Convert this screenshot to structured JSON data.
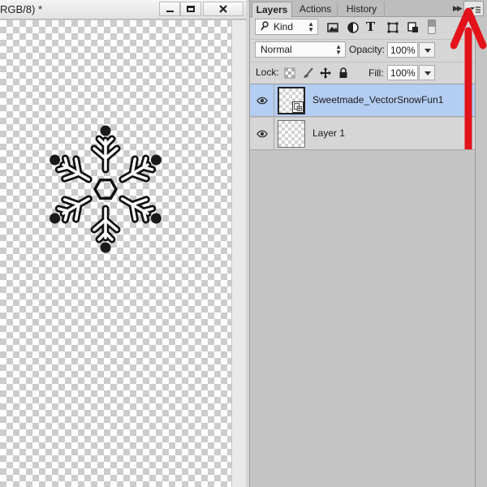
{
  "document": {
    "title": "RGB/8) *",
    "window_buttons": {
      "minimize": "minimize",
      "maximize": "maximize",
      "close": "close"
    }
  },
  "panel": {
    "tabs": [
      {
        "label": "Layers",
        "active": true
      },
      {
        "label": "Actions",
        "active": false
      },
      {
        "label": "History",
        "active": false
      }
    ],
    "collapse_icon": "double-chevron-right",
    "menu_icon": "panel-menu-icon",
    "filter": {
      "kind_label": "Kind",
      "icons": [
        "image-filter-icon",
        "adjustment-filter-icon",
        "type-filter-icon",
        "shape-filter-icon",
        "smart-object-filter-icon"
      ],
      "type_glyph": "T"
    },
    "blend_mode": "Normal",
    "opacity_label": "Opacity:",
    "opacity_value": "100%",
    "lock_label": "Lock:",
    "fill_label": "Fill:",
    "fill_value": "100%",
    "layers": [
      {
        "name": "Sweetmade_VectorSnowFun1",
        "visible": true,
        "selected": true,
        "smart_object": true
      },
      {
        "name": "Layer 1",
        "visible": true,
        "selected": false,
        "smart_object": false
      }
    ]
  },
  "colors": {
    "selected_layer": "#b4cdf2",
    "annotation_arrow": "#e3121b"
  }
}
